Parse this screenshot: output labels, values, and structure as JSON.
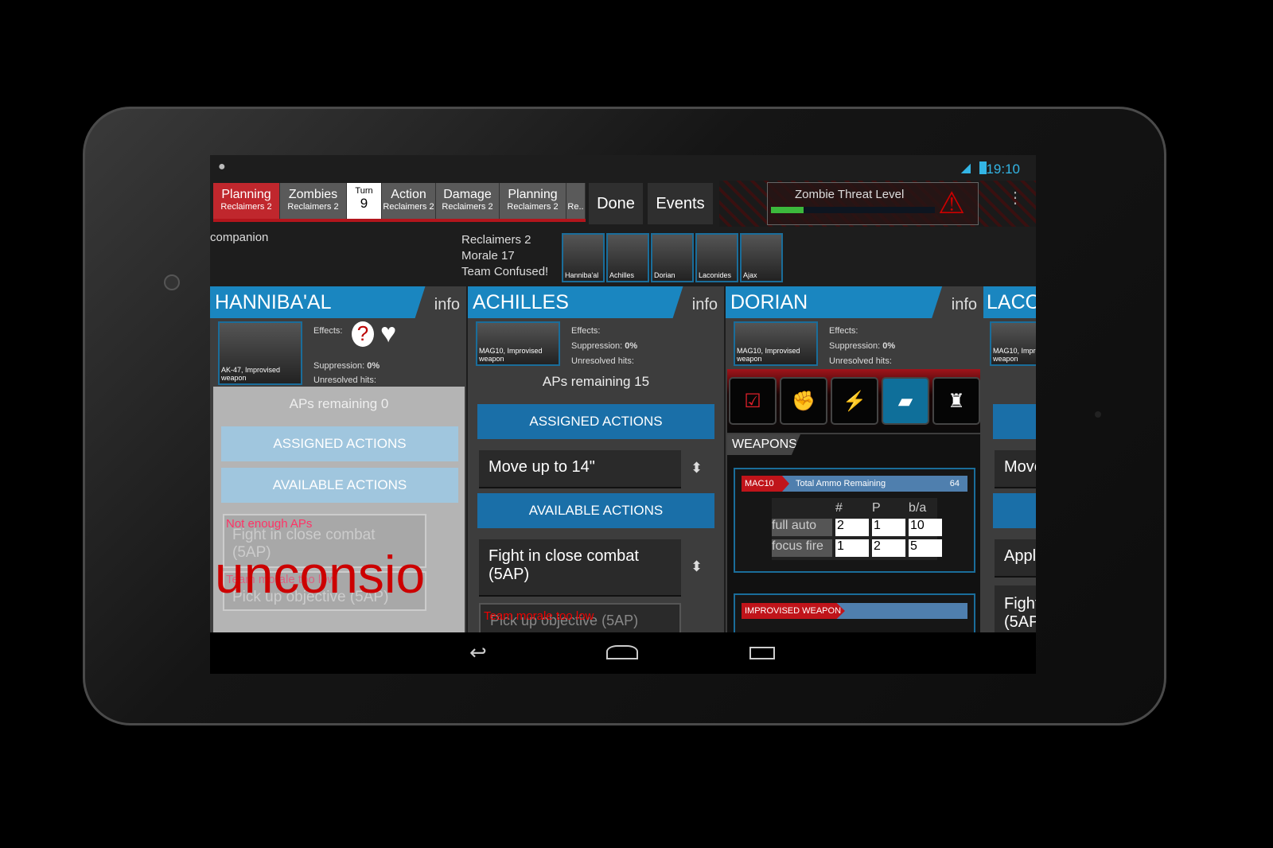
{
  "status": {
    "time": "19:10"
  },
  "phases": [
    {
      "title": "Planning",
      "sub": "Reclaimers 2",
      "active": true
    },
    {
      "title": "Zombies",
      "sub": "Reclaimers 2"
    },
    {
      "title": "Action",
      "sub": "Reclaimers 2"
    },
    {
      "title": "Damage",
      "sub": "Reclaimers 2"
    },
    {
      "title": "Planning",
      "sub": "Reclaimers 2"
    },
    {
      "title": "",
      "sub": "Re.."
    }
  ],
  "turn": {
    "label": "Turn",
    "value": "9"
  },
  "buttons": {
    "done": "Done",
    "events": "Events"
  },
  "threat": {
    "label": "Zombie Threat Level",
    "level_percent": 20
  },
  "companion": "companion",
  "team": {
    "name": "Reclaimers 2",
    "morale": "Morale 17",
    "status": "Team Confused!",
    "members": [
      "Hanniba'al",
      "Achilles",
      "Dorian",
      "Laconides",
      "Ajax"
    ]
  },
  "colors": {
    "accent": "#1a86c0",
    "phase_active": "#c0272d",
    "threat_bar": "#3cb83c"
  },
  "characters": {
    "hannibaal": {
      "name": "HANNIBA'AL",
      "info": "info",
      "weapon": "AK-47, Improvised weapon",
      "effects": "Effects:",
      "suppression": "Suppression:",
      "supp_val": "0%",
      "unresolved": "Unresolved hits:",
      "aps": "APs remaining 0",
      "assigned": "ASSIGNED ACTIONS",
      "available": "AVAILABLE ACTIONS",
      "warn1": "Not enough APs",
      "act1": "Fight in close combat (5AP)",
      "warn2": "Team morale too low",
      "act2": "Pick up objective (5AP)",
      "overlay": "unconsio"
    },
    "achilles": {
      "name": "ACHILLES",
      "info": "info",
      "weapon": "MAG10, Improvised weapon",
      "effects": "Effects:",
      "suppression": "Suppression:",
      "supp_val": "0%",
      "unresolved": "Unresolved hits:",
      "aps": "APs remaining 15",
      "assigned": "ASSIGNED ACTIONS",
      "assigned_item": "Move up to 14\"",
      "available": "AVAILABLE ACTIONS",
      "act1": "Fight in close combat (5AP)",
      "warn2": "Team morale too low",
      "act2": "Pick up objective (5AP)"
    },
    "dorian": {
      "name": "DORIAN",
      "info": "info",
      "weapon": "MAG10, Improvised weapon",
      "effects": "Effects:",
      "suppression": "Suppression:",
      "supp_val": "0%",
      "unresolved": "Unresolved hits:",
      "weapons_header": "WEAPONS",
      "weapon1": {
        "name": "MAC10",
        "ammo_label": "Total Ammo Remaining",
        "ammo": "64",
        "cols": [
          "#",
          "P",
          "b/a"
        ],
        "rows": [
          {
            "label": "full auto",
            "vals": [
              "2",
              "1",
              "10"
            ]
          },
          {
            "label": "focus fire",
            "vals": [
              "1",
              "2",
              "5"
            ]
          }
        ]
      },
      "weapon2": {
        "name": "IMPROVISED WEAPON"
      }
    },
    "laconides": {
      "name": "LACO",
      "weapon": "MAG10, Impro weapon",
      "act_a": "Move",
      "act_b": "Appl",
      "act_c": "Fight (5AP"
    }
  }
}
